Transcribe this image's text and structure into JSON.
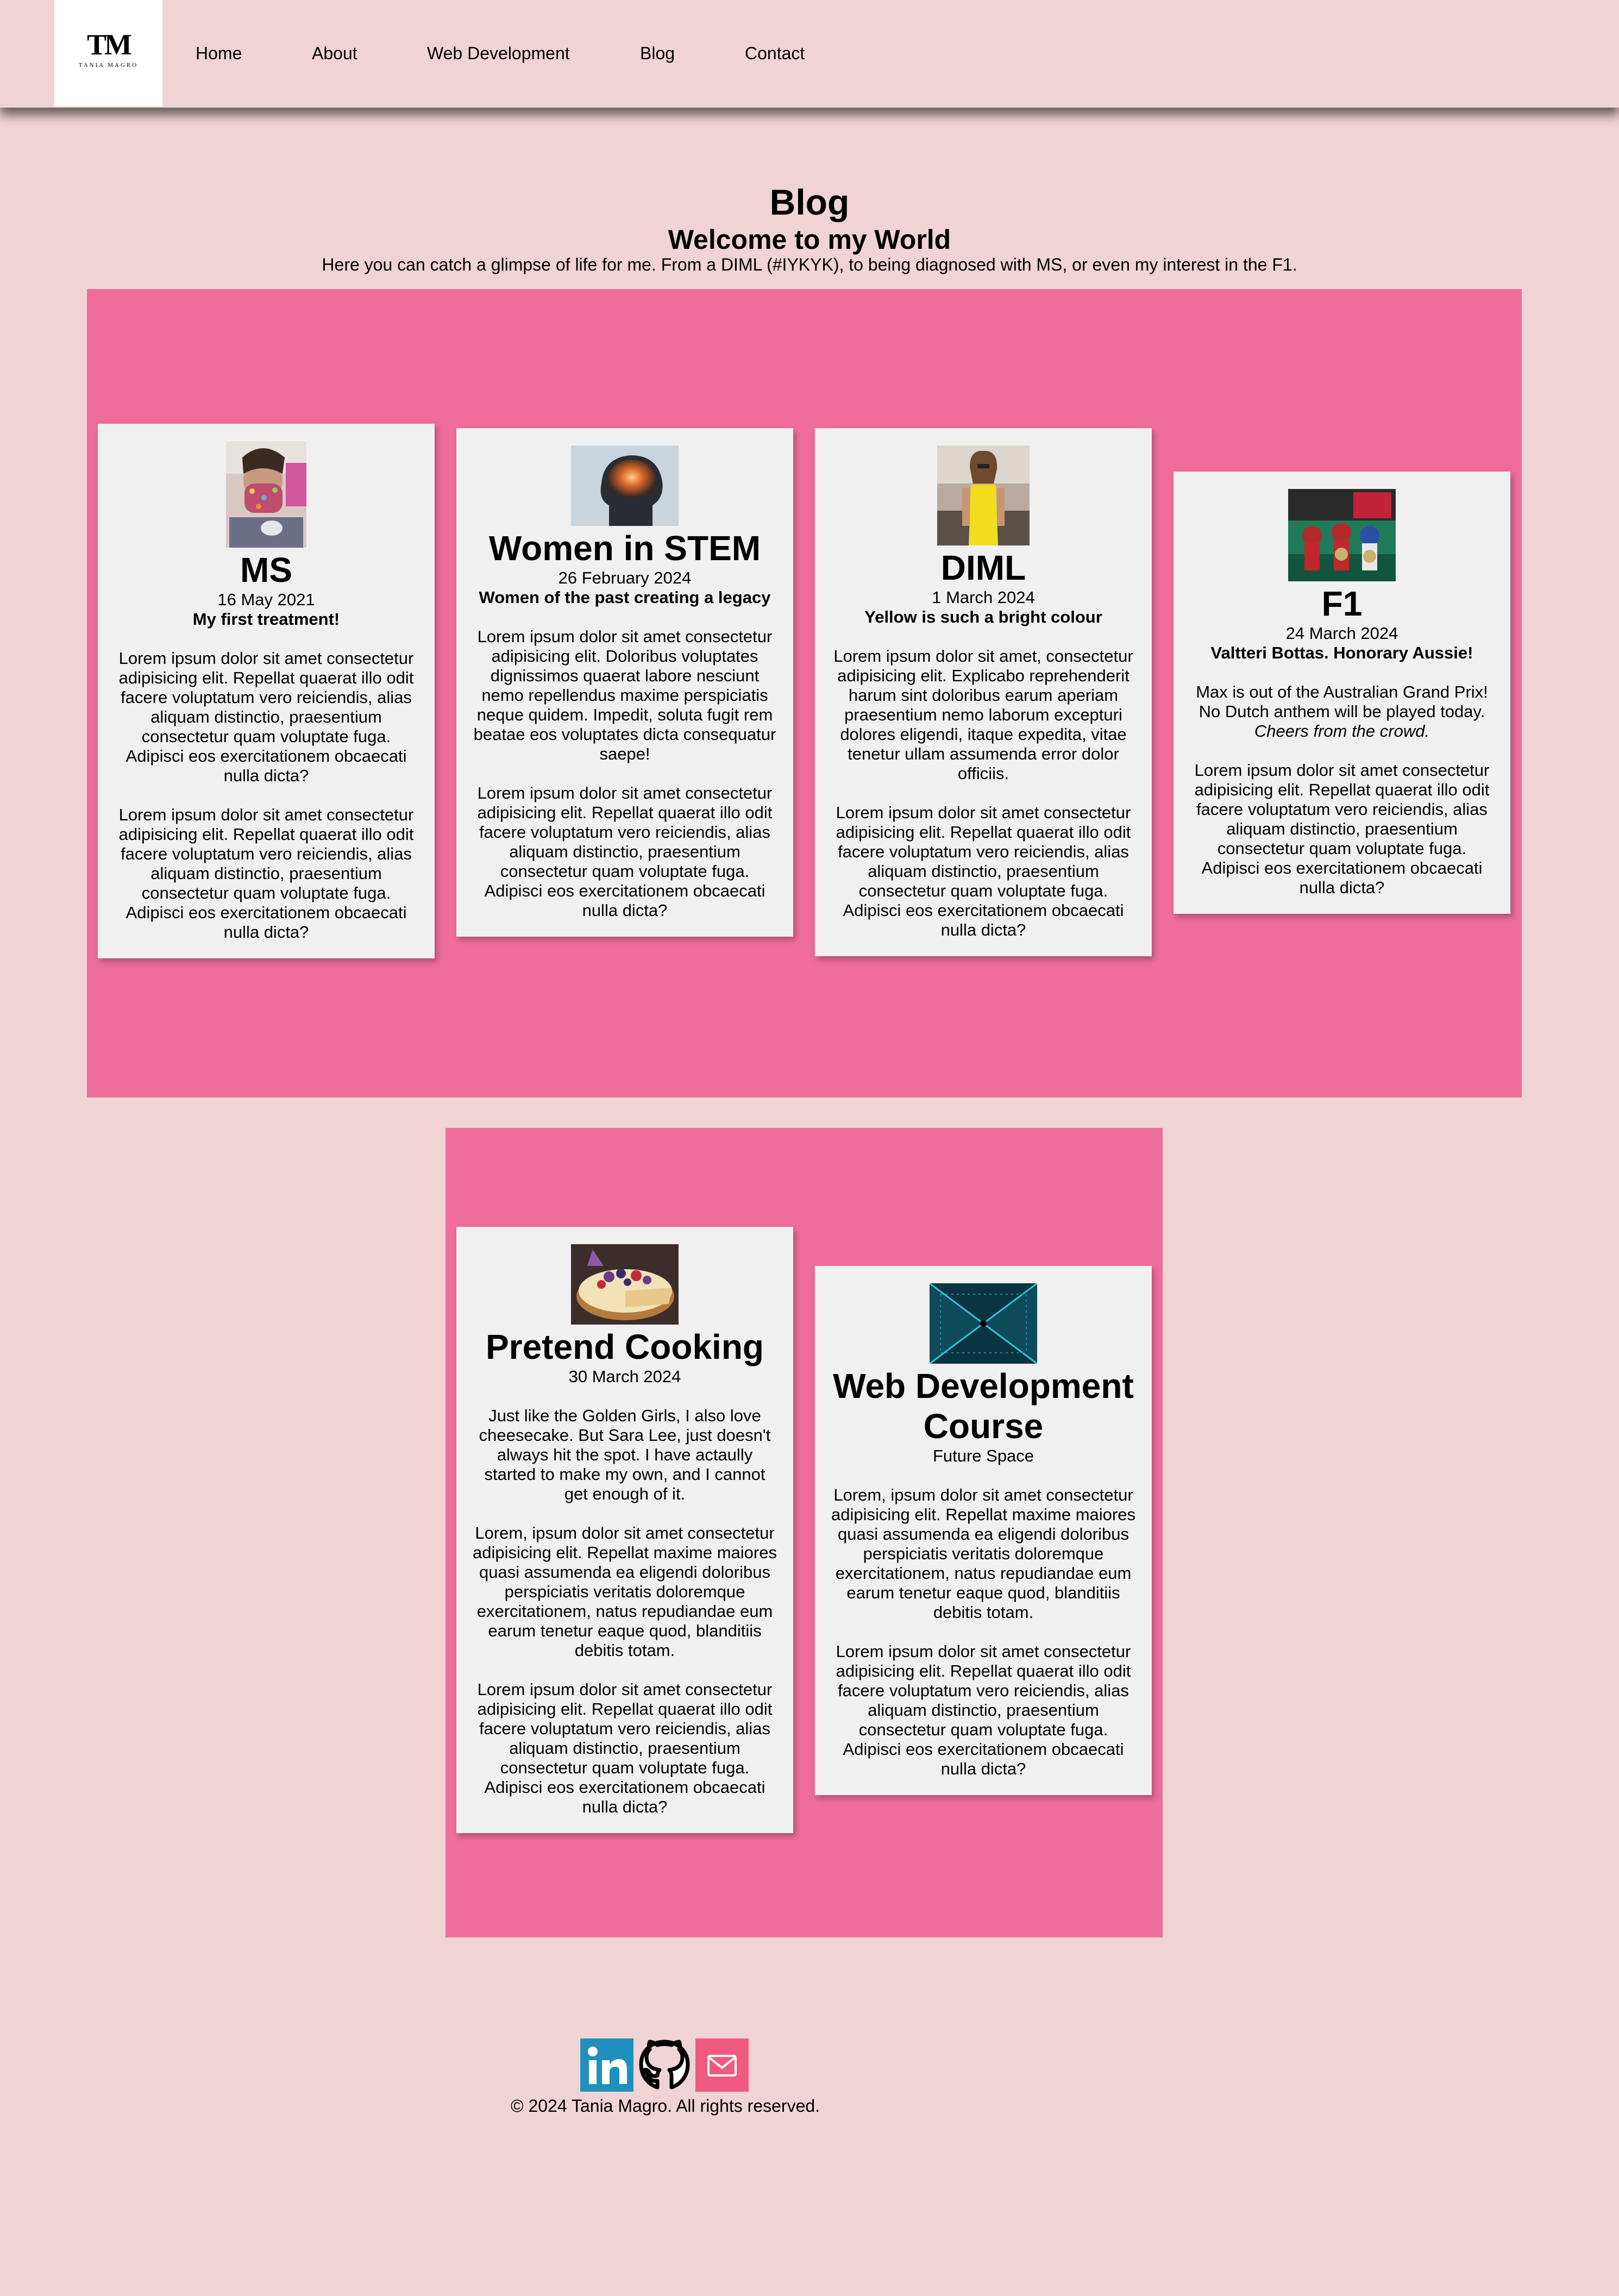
{
  "header": {
    "logo_mark": "TM",
    "logo_sub": "TANIA MAGRO",
    "nav": [
      "Home",
      "About",
      "Web Development",
      "Blog",
      "Contact"
    ]
  },
  "intro": {
    "title": "Blog",
    "subtitle": "Welcome to my World",
    "description": "Here you can catch a glimpse of life for me. From a DIML (#IYKYK), to being diagnosed with MS, or even my interest in the F1."
  },
  "posts": [
    {
      "title": "MS",
      "date": "16 May 2021",
      "subtitle": "My first treatment!",
      "paragraphs": [
        "Lorem ipsum dolor sit amet consectetur adipisicing elit. Repellat quaerat illo odit facere voluptatum vero reiciendis, alias aliquam distinctio, praesentium consectetur quam voluptate fuga. Adipisci eos exercitationem obcaecati nulla dicta?",
        "Lorem ipsum dolor sit amet consectetur adipisicing elit. Repellat quaerat illo odit facere voluptatum vero reiciendis, alias aliquam distinctio, praesentium consectetur quam voluptate fuga. Adipisci eos exercitationem obcaecati nulla dicta?"
      ]
    },
    {
      "title": "Women in STEM",
      "date": "26 February 2024",
      "subtitle": "Women of the past creating a legacy",
      "paragraphs": [
        "Lorem ipsum dolor sit amet consectetur adipisicing elit. Doloribus voluptates dignissimos quaerat labore nesciunt nemo repellendus maxime perspiciatis neque quidem. Impedit, soluta fugit rem beatae eos voluptates dicta consequatur saepe!",
        "Lorem ipsum dolor sit amet consectetur adipisicing elit. Repellat quaerat illo odit facere voluptatum vero reiciendis, alias aliquam distinctio, praesentium consectetur quam voluptate fuga. Adipisci eos exercitationem obcaecati nulla dicta?"
      ]
    },
    {
      "title": "DIML",
      "date": "1 March 2024",
      "subtitle": "Yellow is such a bright colour",
      "paragraphs": [
        "Lorem ipsum dolor sit amet, consectetur adipisicing elit. Explicabo reprehenderit harum sint doloribus earum aperiam praesentium nemo laborum excepturi dolores eligendi, itaque expedita, vitae tenetur ullam assumenda error dolor officiis.",
        "Lorem ipsum dolor sit amet consectetur adipisicing elit. Repellat quaerat illo odit facere voluptatum vero reiciendis, alias aliquam distinctio, praesentium consectetur quam voluptate fuga. Adipisci eos exercitationem obcaecati nulla dicta?"
      ]
    },
    {
      "title": "F1",
      "date": "24 March 2024",
      "subtitle": "Valtteri Bottas. Honorary Aussie!",
      "intro_text": "Max is out of the Australian Grand Prix! No Dutch anthem will be played today.",
      "intro_italic": "Cheers from the crowd.",
      "paragraphs": [
        "Lorem ipsum dolor sit amet consectetur adipisicing elit. Repellat quaerat illo odit facere voluptatum vero reiciendis, alias aliquam distinctio, praesentium consectetur quam voluptate fuga. Adipisci eos exercitationem obcaecati nulla dicta?"
      ]
    },
    {
      "title": "Pretend Cooking",
      "date": "30 March 2024",
      "paragraphs": [
        "Just like the Golden Girls, I also love cheesecake. But Sara Lee, just doesn't always hit the spot. I have actaully started to make my own, and I cannot get enough of it.",
        "Lorem, ipsum dolor sit amet consectetur adipisicing elit. Repellat maxime maiores quasi assumenda ea eligendi doloribus perspiciatis veritatis doloremque exercitationem, natus repudiandae eum earum tenetur eaque quod, blanditiis debitis totam.",
        "Lorem ipsum dolor sit amet consectetur adipisicing elit. Repellat quaerat illo odit facere voluptatum vero reiciendis, alias aliquam distinctio, praesentium consectetur quam voluptate fuga. Adipisci eos exercitationem obcaecati nulla dicta?"
      ]
    },
    {
      "title": "Web Development Course",
      "date": "Future Space",
      "paragraphs": [
        "Lorem, ipsum dolor sit amet consectetur adipisicing elit. Repellat maxime maiores quasi assumenda ea eligendi doloribus perspiciatis veritatis doloremque exercitationem, natus repudiandae eum earum tenetur eaque quod, blanditiis debitis totam.",
        "Lorem ipsum dolor sit amet consectetur adipisicing elit. Repellat quaerat illo odit facere voluptatum vero reiciendis, alias aliquam distinctio, praesentium consectetur quam voluptate fuga. Adipisci eos exercitationem obcaecati nulla dicta?"
      ]
    }
  ],
  "footer": {
    "icons": [
      "linkedin-icon",
      "github-icon",
      "mail-icon"
    ],
    "copyright": "© 2024 Tania Magro. All rights reserved."
  },
  "colors": {
    "page_background": "#f0d3d5",
    "panel": "#ef6d9b",
    "card": "#f1f0f0",
    "linkedin": "#1f8fbd",
    "mail": "#f05a7e"
  }
}
